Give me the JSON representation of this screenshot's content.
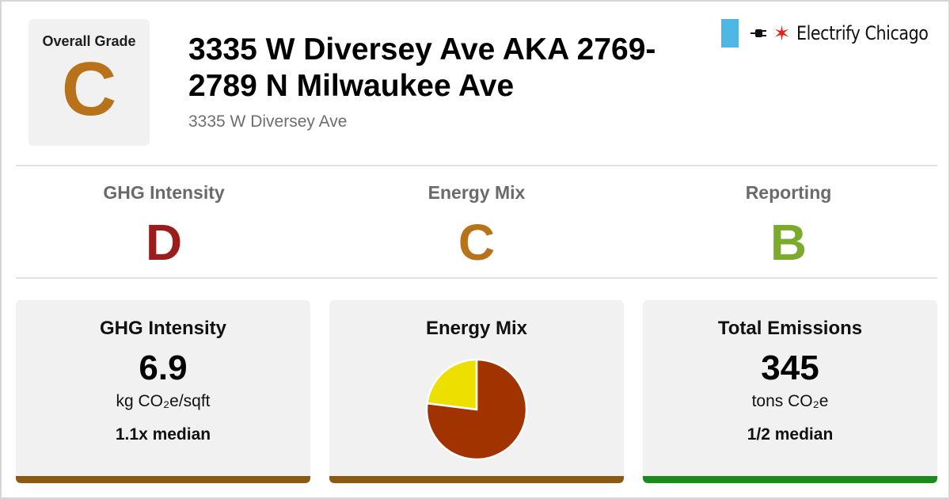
{
  "overall": {
    "label": "Overall Grade",
    "grade": "C",
    "grade_color": "#b8731a"
  },
  "building": {
    "name": "3335 W Diversey Ave AKA 2769-2789 N Milwaukee Ave",
    "address": "3335 W Diversey Ave"
  },
  "brand": {
    "name": "Electrify Chicago",
    "flag_color": "#4fb7e4",
    "star_color": "#e1251b",
    "icons": [
      "chicago-flag-bar-icon",
      "plug-icon",
      "red-star-icon"
    ]
  },
  "subgrades": [
    {
      "label": "GHG Intensity",
      "grade": "D",
      "color": "#9b1c1c"
    },
    {
      "label": "Energy Mix",
      "grade": "C",
      "color": "#b8731a"
    },
    {
      "label": "Reporting",
      "grade": "B",
      "color": "#7cab2c"
    }
  ],
  "cards": {
    "ghg": {
      "title": "GHG Intensity",
      "value": "6.9",
      "unit": "kg CO₂e/sqft",
      "median": "1.1x median",
      "bar_color": "#8a5a14"
    },
    "energy_mix": {
      "title": "Energy Mix",
      "bar_color": "#8a5a14",
      "pie": [
        {
          "share": 0.77,
          "color": "#a03300"
        },
        {
          "share": 0.23,
          "color": "#ede000"
        }
      ]
    },
    "emissions": {
      "title": "Total Emissions",
      "value": "345",
      "unit": "tons CO₂e",
      "median": "1/2 median",
      "bar_color": "#1c8a1c"
    }
  }
}
